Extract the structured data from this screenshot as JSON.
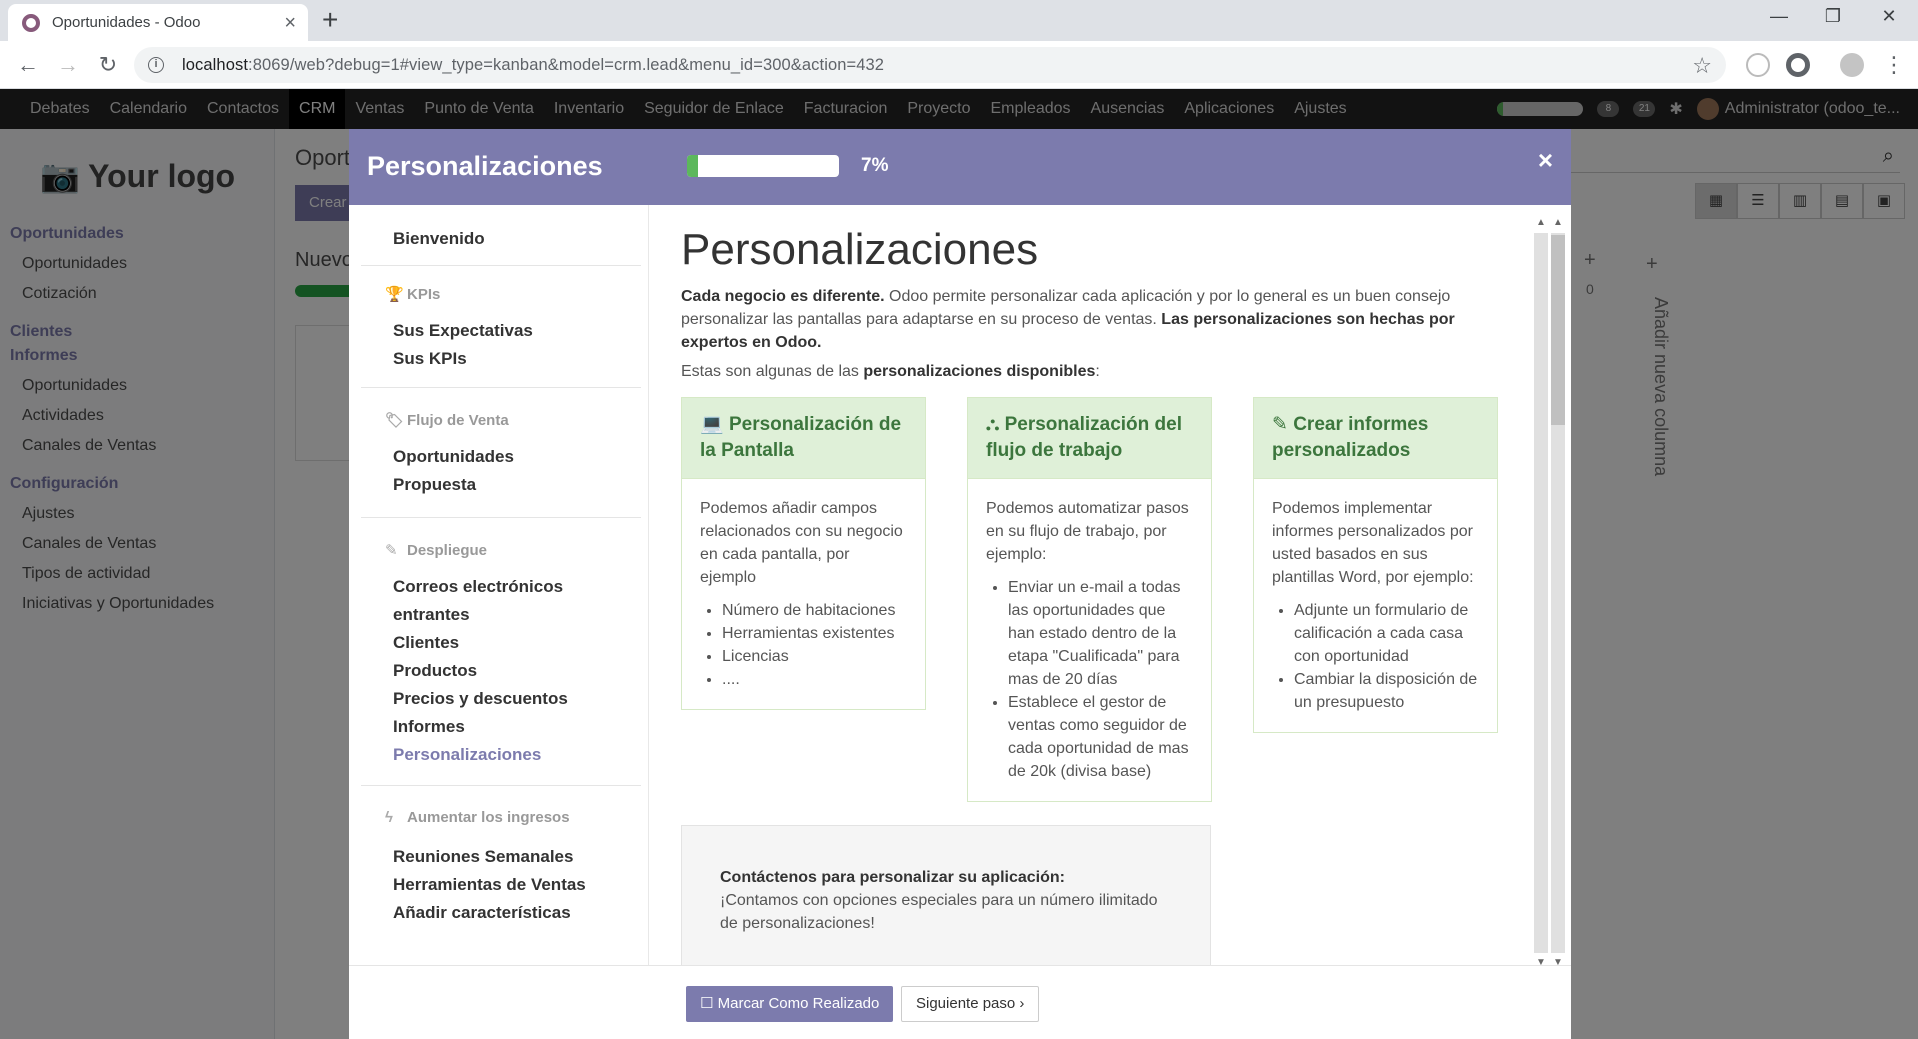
{
  "browser": {
    "tab_title": "Oportunidades - Odoo",
    "url_host": "localhost",
    "url_rest": ":8069/web?debug=1#view_type=kanban&model=crm.lead&menu_id=300&action=432"
  },
  "odoo_nav": {
    "menu": [
      "Debates",
      "Calendario",
      "Contactos",
      "CRM",
      "Ventas",
      "Punto de Venta",
      "Inventario",
      "Seguidor de Enlace",
      "Facturacion",
      "Proyecto",
      "Empleados",
      "Ausencias",
      "Aplicaciones",
      "Ajustes"
    ],
    "active": "CRM",
    "messages_count": "8",
    "activities_count": "21",
    "user": "Administrator (odoo_te..."
  },
  "background": {
    "logo": "Your logo",
    "sidebar": {
      "s1": "Oportunidades",
      "i1": "Oportunidades",
      "i2": "Cotización",
      "s2": "Clientes",
      "s3": "Informes",
      "i3": "Oportunidades",
      "i4": "Actividades",
      "i5": "Canales de Ventas",
      "s4": "Configuración",
      "i6": "Ajustes",
      "i7": "Canales de Ventas",
      "i8": "Tipos de actividad",
      "i9": "Iniciativas y Oportunidades"
    },
    "page_title": "Oport",
    "create_btn": "Crear",
    "column_title": "Nuevo",
    "add_column": "Añadir nueva columna",
    "col_count": "0"
  },
  "modal": {
    "header_title": "Personalizaciones",
    "progress_percent": 7,
    "progress_label": "7%",
    "nav": {
      "welcome": "Bienvenido",
      "kpis_cat": "KPIs",
      "expectations": "Sus Expectativas",
      "kpis": "Sus KPIs",
      "flow_cat": "Flujo de Venta",
      "opportunities": "Oportunidades",
      "proposal": "Propuesta",
      "deploy_cat": "Despliegue",
      "incoming_emails_1": "Correos electrónicos",
      "incoming_emails_2": "entrantes",
      "customers": "Clientes",
      "products": "Productos",
      "pricing": "Precios y descuentos",
      "reports": "Informes",
      "customizations": "Personalizaciones",
      "growth_cat": "Aumentar los ingresos",
      "weekly": "Reuniones Semanales",
      "sales_tools": "Herramientas de Ventas",
      "add_features": "Añadir características"
    },
    "content": {
      "title": "Personalizaciones",
      "intro_bold1": "Cada negocio es diferente.",
      "intro_text": " Odoo permite personalizar cada aplicación y por lo general es un buen consejo personalizar las pantallas para adaptarse en su proceso de ventas. ",
      "intro_bold2": "Las personalizaciones son hechas por expertos en Odoo.",
      "available_pre": "Estas son algunas de las ",
      "available_bold": "personalizaciones disponibles",
      "available_post": ":",
      "cards": [
        {
          "title": "Personalización de la Pantalla",
          "body": "Podemos añadir campos relacionados con su negocio en cada pantalla, por ejemplo",
          "items": [
            "Número de habitaciones",
            "Herramientas existentes",
            "Licencias",
            "...."
          ]
        },
        {
          "title": "Personalización del flujo de trabajo",
          "body": "Podemos automatizar pasos en su flujo de trabajo, por ejemplo:",
          "items": [
            "Enviar un e-mail a todas las oportunidades que han estado dentro de la etapa \"Cualificada\" para mas de 20 días",
            "Establece el gestor de ventas como seguidor de cada oportunidad de mas de 20k (divisa base)"
          ]
        },
        {
          "title": "Crear informes personalizados",
          "body": "Podemos implementar informes personalizados por usted basados en sus plantillas Word, por ejemplo:",
          "items": [
            "Adjunte un formulario de calificación a cada casa con oportunidad",
            "Cambiar la disposición de un presupuesto"
          ]
        }
      ],
      "contact_title": "Contáctenos para personalizar su aplicación:",
      "contact_text": "¡Contamos con opciones especiales para un número ilimitado de personalizaciones!"
    },
    "footer": {
      "mark_done": "Marcar Como Realizado",
      "next": "Siguiente paso"
    }
  }
}
